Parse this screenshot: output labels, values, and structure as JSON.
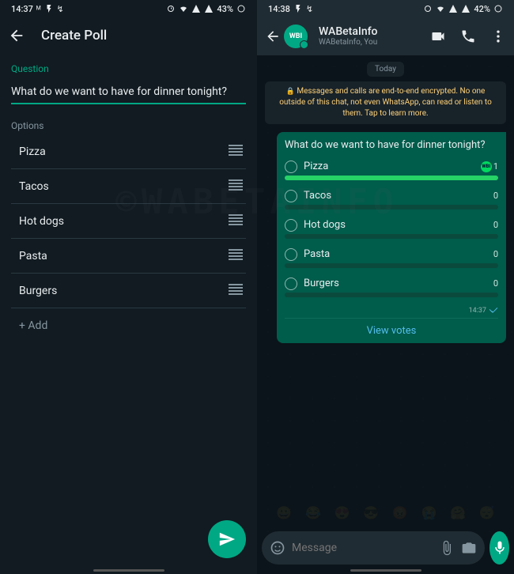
{
  "left_status": {
    "time": "14:37",
    "battery": "43%"
  },
  "right_status": {
    "time": "14:38",
    "battery": "42%"
  },
  "left_header": {
    "title": "Create Poll"
  },
  "poll_form": {
    "question_label": "Question",
    "question_value": "What do we want to have for dinner tonight?",
    "options_label": "Options",
    "options": [
      "Pizza",
      "Tacos",
      "Hot dogs",
      "Pasta",
      "Burgers"
    ],
    "add_label": "+ Add"
  },
  "right_header": {
    "name": "WABetaInfo",
    "members": "WABetaInfo, You",
    "avatar_text": "WBI"
  },
  "chat": {
    "date": "Today",
    "encryption_text": "Messages and calls are end-to-end encrypted. No one outside of this chat, not even WhatsApp, can read or listen to them. Tap to learn more."
  },
  "poll_message": {
    "question": "What do we want to have for dinner tonight?",
    "options": [
      {
        "label": "Pizza",
        "votes": 1,
        "pct": 100,
        "voter": "WBI"
      },
      {
        "label": "Tacos",
        "votes": 0,
        "pct": 0
      },
      {
        "label": "Hot dogs",
        "votes": 0,
        "pct": 0
      },
      {
        "label": "Pasta",
        "votes": 0,
        "pct": 0
      },
      {
        "label": "Burgers",
        "votes": 0,
        "pct": 0
      }
    ],
    "time": "14:37",
    "view_votes": "View votes"
  },
  "input": {
    "placeholder": "Message"
  },
  "watermark": "©WABETAINFO"
}
